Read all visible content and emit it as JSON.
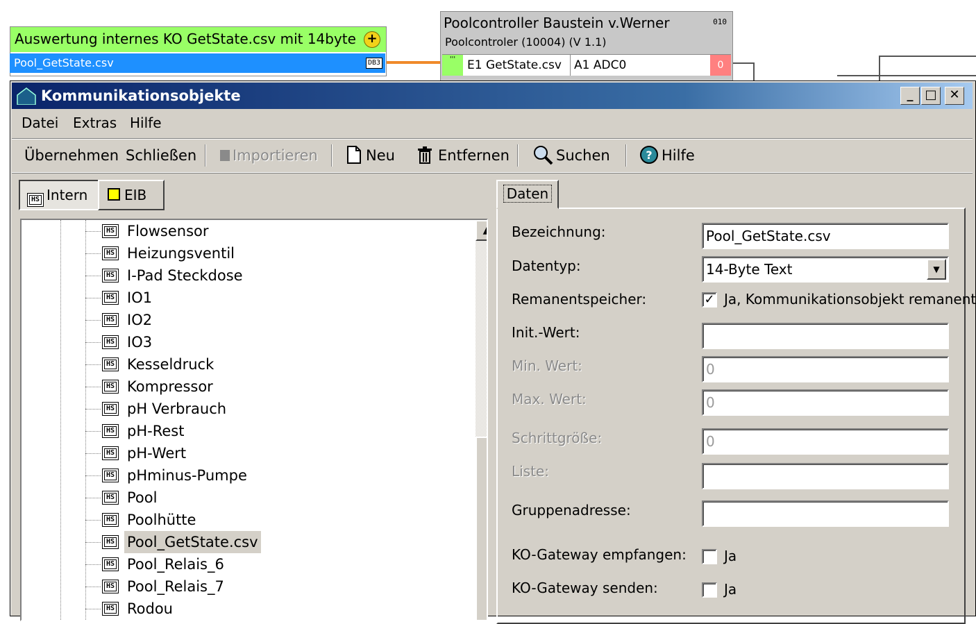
{
  "canvas": {
    "node1": {
      "title": "Auswertung internes KO GetState.csv mit 14byte",
      "plus": "+",
      "output": "Pool_GetState.csv",
      "tag": "DB3"
    },
    "node2": {
      "title": "Poolcontroller Baustein v.Werner",
      "subtitle": "Poolcontroler (10004) (V 1.1)",
      "ver": "010",
      "pin_in": "'''",
      "input": "E1 GetState.csv",
      "output": "A1 ADC0",
      "pin_out": "0"
    }
  },
  "dialog": {
    "title": "Kommunikationsobjekte",
    "menu": [
      "Datei",
      "Extras",
      "Hilfe"
    ],
    "toolbar": {
      "uebernehmen": "Übernehmen",
      "schliessen": "Schließen",
      "importieren": "Importieren",
      "neu": "Neu",
      "entfernen": "Entfernen",
      "suchen": "Suchen",
      "hilfe": "Hilfe"
    },
    "tabs": {
      "intern": "Intern",
      "eib": "EIB",
      "hs": "HS"
    },
    "tree_items": [
      "Flowsensor",
      "Heizungsventil",
      "I-Pad Steckdose",
      "IO1",
      "IO2",
      "IO3",
      "Kesseldruck",
      "Kompressor",
      "pH Verbrauch",
      "pH-Rest",
      "pH-Wert",
      "pHminus-Pumpe",
      "Pool",
      "Poolhütte",
      "Pool_GetState.csv",
      "Pool_Relais_6",
      "Pool_Relais_7",
      "Rodou"
    ],
    "selected_item": "Pool_GetState.csv",
    "data_tab": "Daten",
    "form": {
      "bezeichnung_label": "Bezeichnung:",
      "bezeichnung_value": "Pool_GetState.csv",
      "datentyp_label": "Datentyp:",
      "datentyp_value": "14-Byte Text",
      "remanent_label": "Remanentspeicher:",
      "remanent_text": "Ja, Kommunikationsobjekt remanent",
      "remanent_checked": true,
      "init_label": "Init.-Wert:",
      "init_value": "",
      "min_label": "Min. Wert:",
      "min_value": "0",
      "max_label": "Max. Wert:",
      "max_value": "0",
      "step_label": "Schrittgröße:",
      "step_value": "0",
      "liste_label": "Liste:",
      "liste_value": "",
      "gruppe_label": "Gruppenadresse:",
      "gruppe_value": "",
      "gw_empf_label": "KO-Gateway empfangen:",
      "gw_send_label": "KO-Gateway senden:",
      "ja": "Ja"
    }
  }
}
